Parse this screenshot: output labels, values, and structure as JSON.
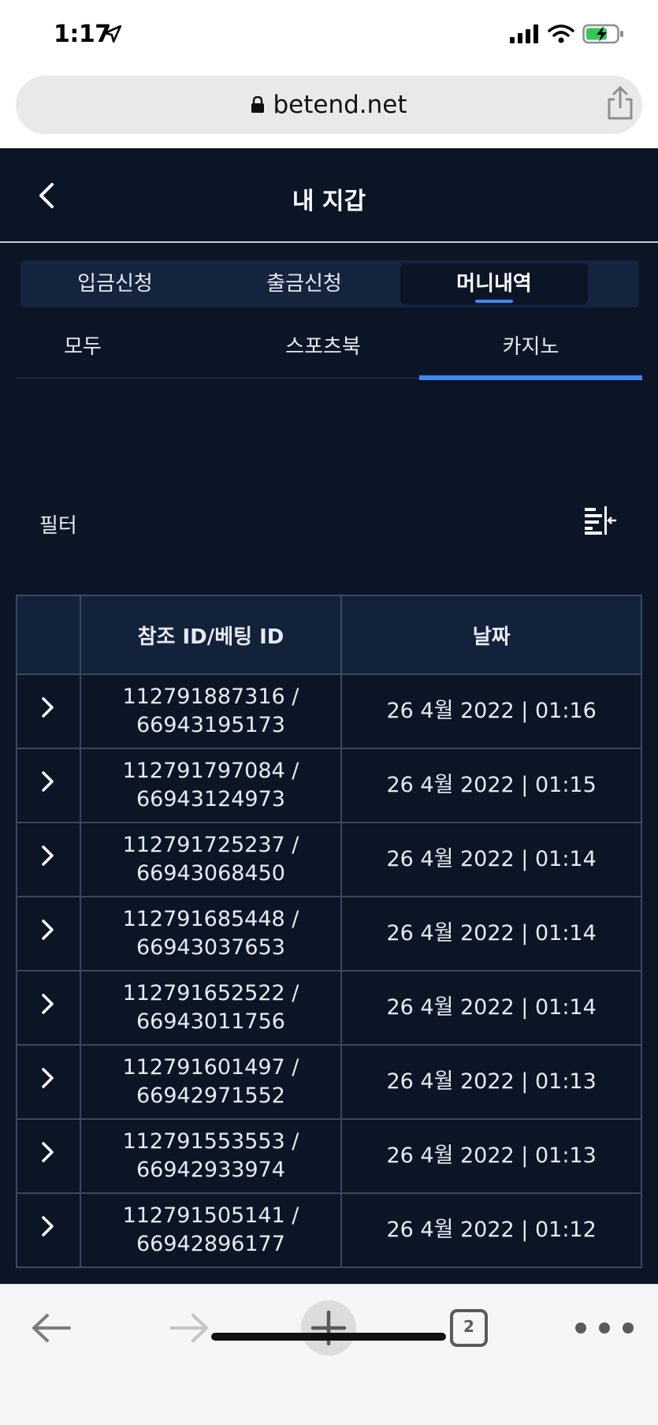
{
  "status_bar": {
    "time": "1:17",
    "icons": [
      "location-arrow-icon",
      "signal-icon",
      "wifi-icon",
      "battery-charging-icon"
    ]
  },
  "browser": {
    "url": "betend.net",
    "tab_count": "2"
  },
  "header": {
    "title": "내 지갑"
  },
  "segments": [
    {
      "label": "입금신청"
    },
    {
      "label": "출금신청"
    },
    {
      "label": "머니내역"
    }
  ],
  "active_segment": "머니내역",
  "tabs": [
    {
      "label": "모두"
    },
    {
      "label": "스포츠북"
    },
    {
      "label": "카지노"
    }
  ],
  "active_tab": "카지노",
  "filter": {
    "label": "필터"
  },
  "table": {
    "headers": [
      "",
      "참조 ID/베팅 ID",
      "날짜"
    ],
    "rows": [
      {
        "ref": "112791887316 /",
        "bet": "66943195173",
        "date": "26 4월 2022 | 01:16"
      },
      {
        "ref": "112791797084 /",
        "bet": "66943124973",
        "date": "26 4월 2022 | 01:15"
      },
      {
        "ref": "112791725237 /",
        "bet": "66943068450",
        "date": "26 4월 2022 | 01:14"
      },
      {
        "ref": "112791685448 /",
        "bet": "66943037653",
        "date": "26 4월 2022 | 01:14"
      },
      {
        "ref": "112791652522 /",
        "bet": "66943011756",
        "date": "26 4월 2022 | 01:14"
      },
      {
        "ref": "112791601497 /",
        "bet": "66942971552",
        "date": "26 4월 2022 | 01:13"
      },
      {
        "ref": "112791553553 /",
        "bet": "66942933974",
        "date": "26 4월 2022 | 01:13"
      },
      {
        "ref": "112791505141 /",
        "bet": "66942896177",
        "date": "26 4월 2022 | 01:12"
      }
    ]
  },
  "colors": {
    "background": "#0b1526",
    "accent": "#3d8bf0",
    "border": "#3b4760"
  }
}
